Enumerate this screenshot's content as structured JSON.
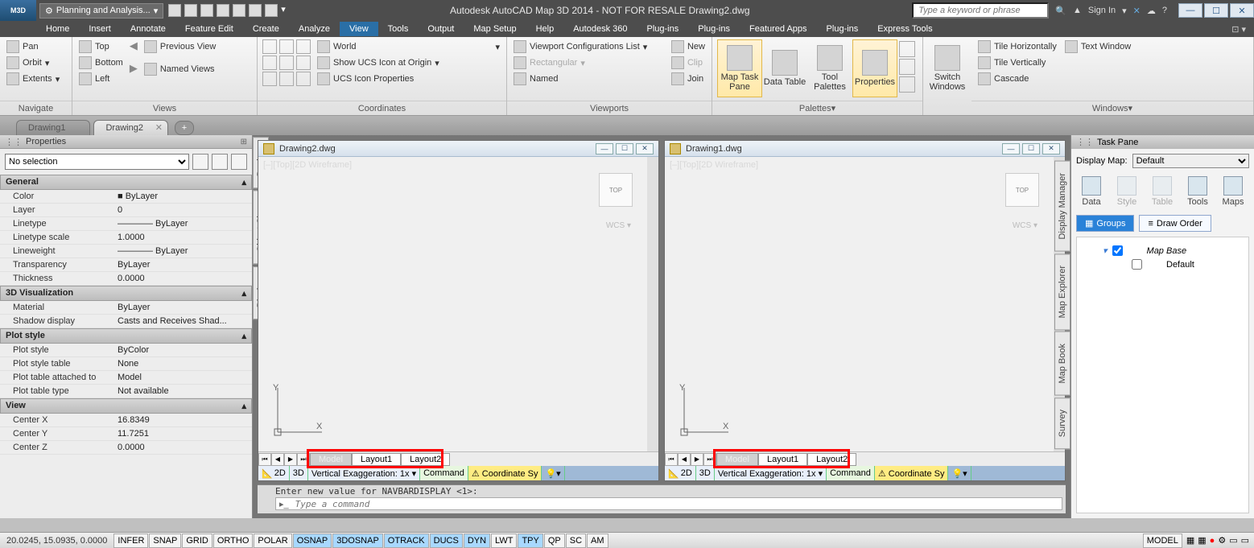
{
  "title": "Autodesk AutoCAD Map 3D 2014 - NOT FOR RESALE     Drawing2.dwg",
  "workspace_label": "Planning and Analysis...",
  "search_placeholder": "Type a keyword or phrase",
  "signin_label": "Sign In",
  "ribbon_tabs": [
    "Home",
    "Insert",
    "Annotate",
    "Feature Edit",
    "Create",
    "Analyze",
    "View",
    "Tools",
    "Output",
    "Map Setup",
    "Help",
    "Autodesk 360",
    "Plug-ins",
    "Plug-ins",
    "Featured Apps",
    "Plug-ins",
    "Express Tools"
  ],
  "active_ribbon_tab": "View",
  "ribbon": {
    "navigate": {
      "label": "Navigate",
      "items": [
        "Pan",
        "Orbit",
        "Extents"
      ]
    },
    "views": {
      "label": "Views",
      "items": [
        "Top",
        "Bottom",
        "Left"
      ],
      "right": [
        "Previous View",
        "Named Views"
      ]
    },
    "coordinates": {
      "label": "Coordinates",
      "world": "World",
      "show": "Show UCS Icon at Origin",
      "props": "UCS Icon Properties"
    },
    "viewports": {
      "label": "Viewports",
      "config": "Viewport Configurations List",
      "rect": "Rectangular",
      "named": "Named",
      "new": "New",
      "clip": "Clip",
      "join": "Join"
    },
    "palettes": {
      "label": "Palettes",
      "map": "Map Task Pane",
      "data": "Data Table",
      "tool": "Tool Palettes",
      "props": "Properties"
    },
    "switch": {
      "label": "Switch Windows",
      "btn": "Switch Windows"
    },
    "windows": {
      "label": "Windows",
      "th": "Tile Horizontally",
      "tv": "Tile Vertically",
      "cas": "Cascade",
      "tw": "Text Window"
    }
  },
  "doc_tabs": [
    {
      "name": "Drawing1",
      "active": false
    },
    {
      "name": "Drawing2",
      "active": true
    }
  ],
  "properties": {
    "title": "Properties",
    "selection": "No selection",
    "groups": [
      {
        "name": "General",
        "rows": [
          {
            "k": "Color",
            "v": "■ ByLayer"
          },
          {
            "k": "Layer",
            "v": "0"
          },
          {
            "k": "Linetype",
            "v": "———— ByLayer"
          },
          {
            "k": "Linetype scale",
            "v": "1.0000"
          },
          {
            "k": "Lineweight",
            "v": "———— ByLayer"
          },
          {
            "k": "Transparency",
            "v": "ByLayer"
          },
          {
            "k": "Thickness",
            "v": "0.0000"
          }
        ]
      },
      {
        "name": "3D Visualization",
        "rows": [
          {
            "k": "Material",
            "v": "ByLayer"
          },
          {
            "k": "Shadow display",
            "v": "Casts and Receives Shad..."
          }
        ]
      },
      {
        "name": "Plot style",
        "rows": [
          {
            "k": "Plot style",
            "v": "ByColor"
          },
          {
            "k": "Plot style table",
            "v": "None"
          },
          {
            "k": "Plot table attached to",
            "v": "Model"
          },
          {
            "k": "Plot table type",
            "v": "Not available"
          }
        ]
      },
      {
        "name": "View",
        "rows": [
          {
            "k": "Center X",
            "v": "16.8349"
          },
          {
            "k": "Center Y",
            "v": "11.7251"
          },
          {
            "k": "Center Z",
            "v": "0.0000"
          }
        ]
      }
    ]
  },
  "side_tabs": [
    "Design",
    "Object Class",
    "Display"
  ],
  "docwins": [
    {
      "title": "Drawing2.dwg",
      "viewlabel": "[–][Top][2D Wireframe]",
      "wcs": "WCS"
    },
    {
      "title": "Drawing1.dwg",
      "viewlabel": "[–][Top][2D Wireframe]",
      "wcs": "WCS"
    }
  ],
  "layout_tabs": [
    "Model",
    "Layout1",
    "Layout2"
  ],
  "doc_status": {
    "_2d": "2D",
    "_3d": "3D",
    "ve": "Vertical Exaggeration:",
    "vex": "1x",
    "cmd": "Command",
    "cs": "Coordinate Sy"
  },
  "cmd_history": "Enter new value for NAVBARDISPLAY <1>:",
  "cmd_placeholder": "Type a command",
  "task_pane": {
    "title": "Task Pane",
    "display_map_label": "Display Map:",
    "display_map_value": "Default",
    "tools": [
      {
        "n": "Data"
      },
      {
        "n": "Style",
        "dim": true
      },
      {
        "n": "Table",
        "dim": true
      },
      {
        "n": "Tools"
      },
      {
        "n": "Maps"
      }
    ],
    "tabs": {
      "groups": "Groups",
      "draw": "Draw Order"
    },
    "tree": [
      {
        "name": "Map Base",
        "italic": true
      },
      {
        "name": "Default"
      }
    ]
  },
  "tp_vtabs": [
    "Display Manager",
    "Map Explorer",
    "Map Book",
    "Survey"
  ],
  "status": {
    "coord": "20.0245, 15.0935, 0.0000",
    "toggles": [
      {
        "t": "INFER"
      },
      {
        "t": "SNAP"
      },
      {
        "t": "GRID"
      },
      {
        "t": "ORTHO"
      },
      {
        "t": "POLAR"
      },
      {
        "t": "OSNAP",
        "on": true
      },
      {
        "t": "3DOSNAP",
        "on": true
      },
      {
        "t": "OTRACK",
        "on": true
      },
      {
        "t": "DUCS",
        "on": true
      },
      {
        "t": "DYN",
        "on": true
      },
      {
        "t": "LWT"
      },
      {
        "t": "TPY",
        "on": true
      },
      {
        "t": "QP"
      },
      {
        "t": "SC"
      },
      {
        "t": "AM"
      }
    ],
    "model": "MODEL"
  },
  "icons": {
    "min": "—",
    "max": "☐",
    "close": "✕"
  }
}
